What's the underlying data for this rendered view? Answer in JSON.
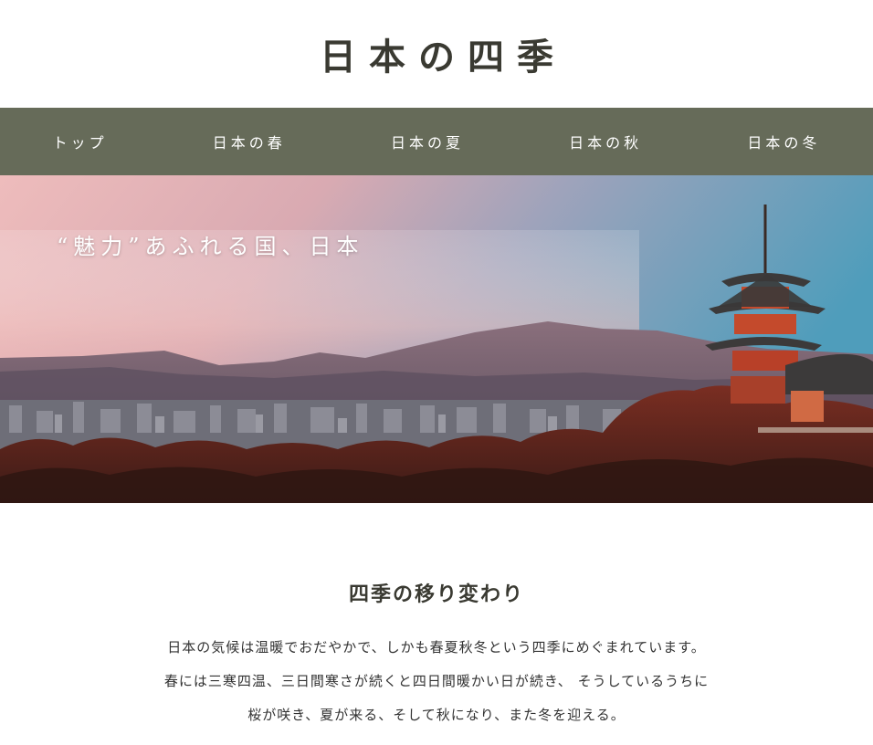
{
  "header": {
    "title": "日本の四季"
  },
  "nav": {
    "items": [
      {
        "label": "トップ"
      },
      {
        "label": "日本の春"
      },
      {
        "label": "日本の夏"
      },
      {
        "label": "日本の秋"
      },
      {
        "label": "日本の冬"
      }
    ]
  },
  "hero": {
    "caption": "“魅力”あふれる国、日本",
    "image": "kyoto-pagoda-cityscape-sunset"
  },
  "section": {
    "heading": "四季の移り変わり",
    "lines": [
      "日本の気候は温暖でおだやかで、しかも春夏秋冬という四季にめぐまれています。",
      "春には三寒四温、三日間寒さが続くと四日間暖かい日が続き、 そうしているうちに",
      "桜が咲き、夏が来る、そして秋になり、また冬を迎える。"
    ]
  },
  "colors": {
    "nav_background": "#666b59",
    "title_text": "#3a3a32"
  }
}
